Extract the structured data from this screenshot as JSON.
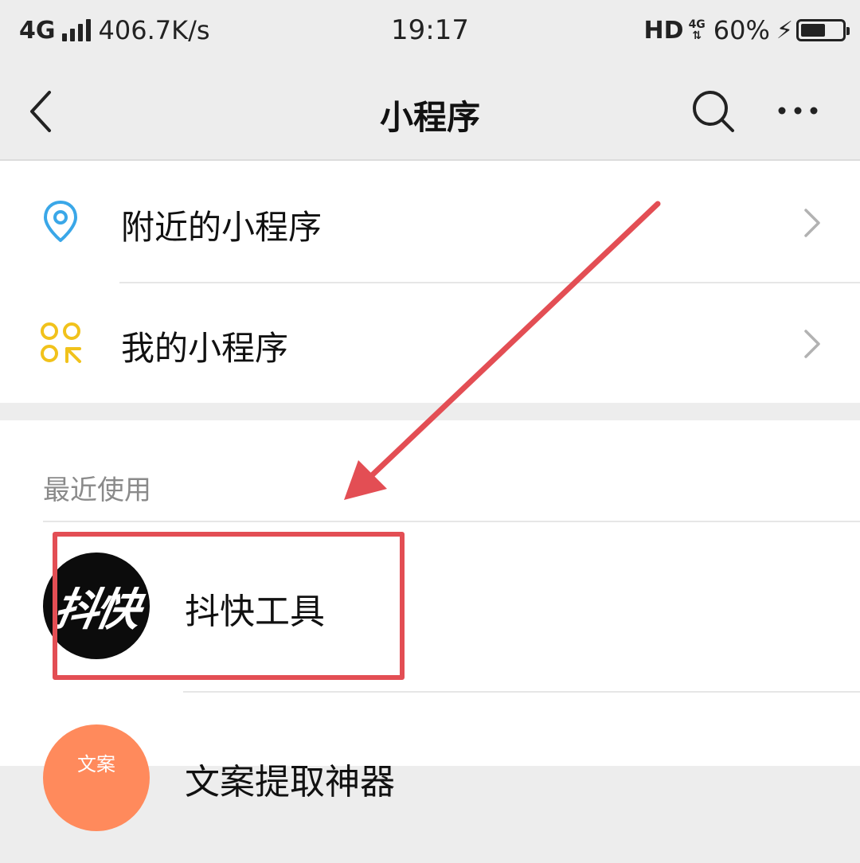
{
  "status_bar": {
    "network": "4G",
    "speed": "406.7K/s",
    "time": "19:17",
    "hd": "HD",
    "mini_network": "4G",
    "battery": "60%",
    "battery_level": 0.6
  },
  "nav": {
    "title": "小程序",
    "back_icon": "chevron-left-icon",
    "search_icon": "search-icon",
    "more_icon": "more-dots-icon"
  },
  "menu": {
    "items": [
      {
        "label": "附近的小程序",
        "icon": "location-pin-icon",
        "icon_color": "#3aa7e8"
      },
      {
        "label": "我的小程序",
        "icon": "mini-program-grid-icon",
        "icon_color": "#f1c21b"
      }
    ]
  },
  "recent": {
    "header": "最近使用",
    "apps": [
      {
        "name": "抖快工具",
        "avatar_text": "抖快",
        "avatar_color": "#0c0c0c"
      },
      {
        "name": "文案提取神器",
        "avatar_text": "文案",
        "avatar_color": "#ff8a5c"
      }
    ]
  },
  "colors": {
    "background": "#ededed",
    "annotation": "#e34e54"
  }
}
